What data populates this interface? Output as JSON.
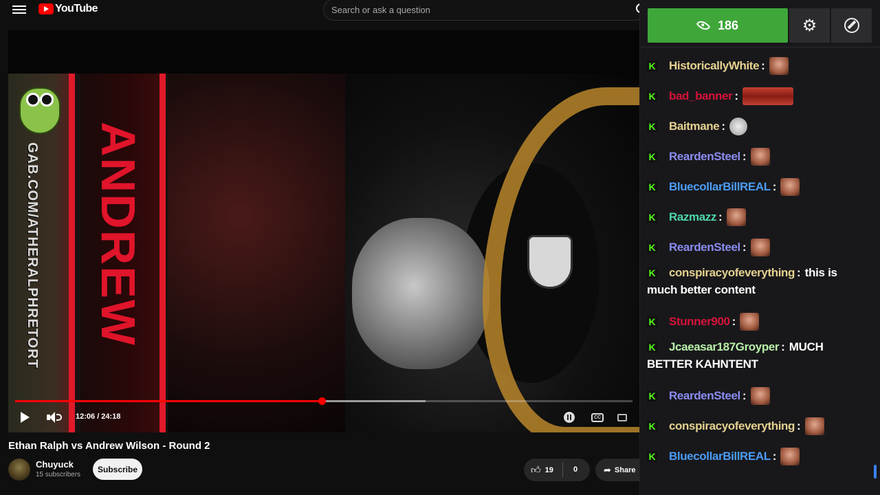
{
  "header": {
    "logo_text": "YouTube",
    "search_placeholder": "Search or ask a question"
  },
  "player": {
    "current_time": "12:06",
    "duration": "24:18",
    "time_display": "12:06 / 24:18",
    "progress_fraction": 0.497,
    "buffered_fraction": 0.665,
    "accent_color": "#ff0000",
    "overlay_side_text": "GAB.COM/ATHERALPHRETORT",
    "overlay_big_text": "ANDREW"
  },
  "video": {
    "title": "Ethan Ralph vs Andrew Wilson - Round 2",
    "channel": "Chuyuck",
    "subscribers": "15 subscribers",
    "subscribe_label": "Subscribe",
    "likes": "19",
    "dislikes": "0",
    "share_label": "Share"
  },
  "chat": {
    "viewer_count": "186",
    "badge_letter": "K",
    "brand_color": "#3fa73a",
    "messages": [
      {
        "user": "HistoricallyWhite",
        "color": "#e5d190",
        "emote": "face-emote",
        "text": "",
        "cont": ""
      },
      {
        "user": "bad_banner",
        "color": "#d6133a",
        "emote": "lips-emote",
        "text": "",
        "cont": ""
      },
      {
        "user": "Baitmane",
        "color": "#e5d190",
        "emote": "cat-emote",
        "text": "",
        "cont": ""
      },
      {
        "user": "ReardenSteel",
        "color": "#8a8cf0",
        "emote": "face-emote",
        "text": "",
        "cont": ""
      },
      {
        "user": "BluecollarBillREAL",
        "color": "#4b9cf5",
        "emote": "face-emote",
        "text": "",
        "cont": ""
      },
      {
        "user": "Razmazz",
        "color": "#4fd6a8",
        "emote": "face-emote",
        "text": "",
        "cont": ""
      },
      {
        "user": "ReardenSteel",
        "color": "#8a8cf0",
        "emote": "face-emote",
        "text": "",
        "cont": ""
      },
      {
        "user": "conspiracyofeverything",
        "color": "#e5d190",
        "emote": "",
        "text": "this is",
        "cont": "much better content"
      },
      {
        "user": "Stunner900",
        "color": "#d6133a",
        "emote": "face-emote",
        "text": "",
        "cont": ""
      },
      {
        "user": "Jcaeasar187Groyper",
        "color": "#b8f0a8",
        "emote": "",
        "text": "MUCH",
        "cont": "BETTER KAHNTENT"
      },
      {
        "user": "ReardenSteel",
        "color": "#8a8cf0",
        "emote": "face-emote",
        "text": "",
        "cont": ""
      },
      {
        "user": "conspiracyofeverything",
        "color": "#e5d190",
        "emote": "face-emote",
        "text": "",
        "cont": ""
      },
      {
        "user": "BluecollarBillREAL",
        "color": "#4b9cf5",
        "emote": "face-emote",
        "text": "",
        "cont": ""
      }
    ]
  }
}
